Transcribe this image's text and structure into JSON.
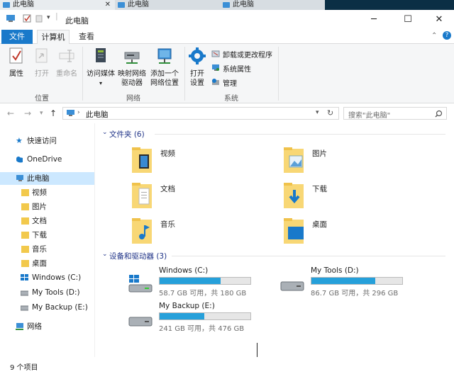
{
  "tabs": [
    "此电脑",
    "此电脑",
    "此电脑"
  ],
  "window": {
    "title": "此电脑"
  },
  "ribbon": {
    "tabs": {
      "file": "文件",
      "computer": "计算机",
      "view": "查看"
    },
    "location": {
      "properties": "属性",
      "open": "打开",
      "rename": "重命名",
      "label": "位置"
    },
    "network": {
      "access_media": "访问媒体",
      "map_drive_1": "映射网络",
      "map_drive_2": "驱动器",
      "add_location_1": "添加一个",
      "add_location_2": "网络位置",
      "label": "网络"
    },
    "system": {
      "open_settings_1": "打开",
      "open_settings_2": "设置",
      "uninstall": "卸载或更改程序",
      "system_props": "系统属性",
      "manage": "管理",
      "label": "系统"
    }
  },
  "address": {
    "path": "此电脑",
    "search_placeholder": "搜索\"此电脑\""
  },
  "nav": {
    "quick_access": "快速访问",
    "onedrive": "OneDrive",
    "this_pc": "此电脑",
    "videos": "视频",
    "pictures": "图片",
    "documents": "文档",
    "downloads": "下载",
    "music": "音乐",
    "desktop": "桌面",
    "drive_c": "Windows (C:)",
    "drive_d": "My Tools (D:)",
    "drive_e": "My Backup (E:)",
    "network": "网络"
  },
  "folders_section": {
    "title": "文件夹 (6)",
    "items": [
      "视频",
      "图片",
      "文档",
      "下载",
      "音乐",
      "桌面"
    ]
  },
  "devices_section": {
    "title": "设备和驱动器 (3)",
    "drives": [
      {
        "name": "Windows (C:)",
        "free": "58.7 GB 可用，共 180 GB",
        "used_fraction": 0.674
      },
      {
        "name": "My Tools (D:)",
        "free": "86.7 GB 可用，共 296 GB",
        "used_fraction": 0.707
      },
      {
        "name": "My Backup (E:)",
        "free": "241 GB 可用，共 476 GB",
        "used_fraction": 0.494
      }
    ]
  },
  "status": {
    "count": "9 个项目"
  },
  "colors": {
    "accent": "#1979ca",
    "drive_bar": "#26a0da",
    "selection": "#cce8ff",
    "folder": "#f8d775"
  }
}
